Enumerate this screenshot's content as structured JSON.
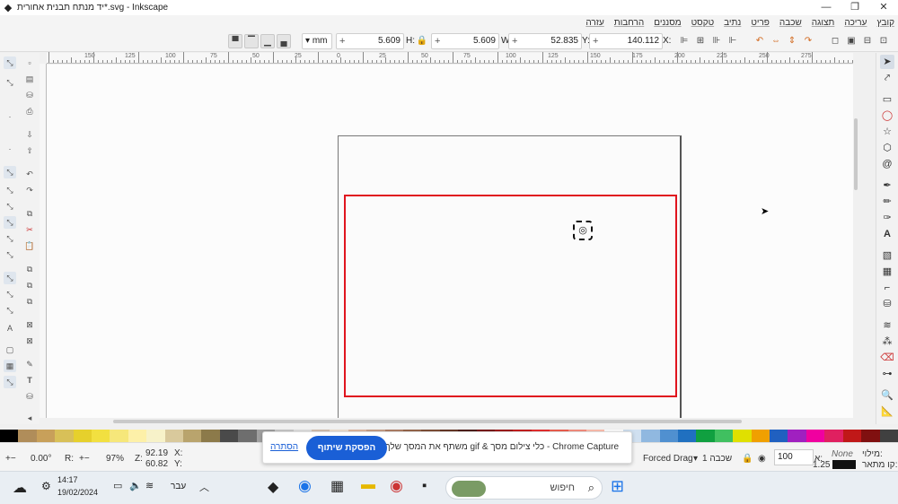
{
  "window": {
    "title": "יד מנתח תבנית אחורית*.svg - Inkscape",
    "app_icon": "inkscape-icon",
    "controls": [
      "minimize-icon",
      "maximize-icon",
      "close-icon"
    ]
  },
  "menu": {
    "items": [
      "קובץ",
      "עריכה",
      "תצוגה",
      "שכבה",
      "פריט",
      "נתיב",
      "טקסט",
      "מסננים",
      "הרחבות",
      "עזרה"
    ]
  },
  "toolctrl": {
    "x_label": "X:",
    "x_value": "140.112",
    "y_label": "Y:",
    "y_value": "52.835",
    "w_label": "W:",
    "w_value": "5.609",
    "h_label": "H:",
    "h_value": "5.609",
    "unit": "mm",
    "plus": "+",
    "minus": "−"
  },
  "ruler": {
    "labels": [
      "150",
      "125",
      "100",
      "75",
      "50",
      "25",
      "0",
      "25",
      "50",
      "75",
      "100",
      "125",
      "150",
      "175",
      "200",
      "225",
      "250",
      "275"
    ]
  },
  "palette": {
    "colors": [
      "#000000",
      "#b08d5a",
      "#c8a05a",
      "#d8c058",
      "#e6d02c",
      "#f2e040",
      "#f6e77a",
      "#fdf0a8",
      "#f7f2c9",
      "#d9c99c",
      "#b9a46d",
      "#8c7a4a",
      "#4a4a4a",
      "#6e6e6e",
      "#a0a0a0",
      "#c8c8c8",
      "#e0e0e0",
      "#d4c0b0",
      "#f0e0d0",
      "#e0b8a0",
      "#c8a088",
      "#b08068",
      "#98684c",
      "#805038",
      "#683828",
      "#502018",
      "#7a1010",
      "#a01818",
      "#c82020",
      "#e83030",
      "#f06050",
      "#f89080",
      "#ffc0b0",
      "#ffffff",
      "#d0e0f0",
      "#90b8e0",
      "#5090d0",
      "#2070c0",
      "#10a040",
      "#40c060",
      "#e0e000",
      "#f0a000",
      "#2060c0",
      "#a020c0",
      "#f000a0",
      "#e02060",
      "#c01818",
      "#801010",
      "#404040"
    ]
  },
  "status": {
    "rotation": "0.00°",
    "rotation_pm": "+−",
    "r_label": "R:",
    "zoom": "97%",
    "z_label": "Z:",
    "x_coord": "92.19",
    "y_coord": "60.82",
    "x_label": "X:",
    "y_label": "Y:",
    "forced_drag": "Forced Drag",
    "layer": "שכבה 1",
    "opacity_label": "א:",
    "opacity": "100",
    "stroke_label": "קו מתאר:",
    "fill_label": "מילוי:",
    "fill_value": "None",
    "stroke_width": "1.25"
  },
  "share_bar": {
    "message": "Chrome Capture - כלי צילום מסך & gif משתף את המסך שלך.",
    "stop_button": "הפסקת שיתוף",
    "hide_link": "הסתרה"
  },
  "taskbar": {
    "time": "14:17",
    "date": "19/02/2024",
    "language": "עבר",
    "search_label": "חיפוש",
    "apps": [
      "inkscape-icon",
      "chrome-icon",
      "calculator-icon",
      "file-explorer-icon",
      "chrome-profile-icon",
      "terminal-icon"
    ]
  }
}
